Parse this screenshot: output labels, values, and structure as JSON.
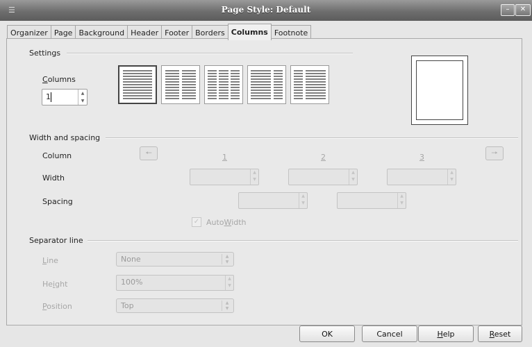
{
  "window": {
    "title": "Page Style: Default"
  },
  "tabs": [
    {
      "label": "Organizer"
    },
    {
      "label": "Page"
    },
    {
      "label": "Background"
    },
    {
      "label": "Header"
    },
    {
      "label": "Footer"
    },
    {
      "label": "Borders"
    },
    {
      "label": "Columns"
    },
    {
      "label": "Footnote"
    }
  ],
  "active_tab": "Columns",
  "settings": {
    "heading": "Settings",
    "columns_label_letter": "C",
    "columns_label_rest": "olumns",
    "columns_value": "1",
    "layouts": [
      "1 column",
      "2 columns",
      "3 columns",
      "2 columns left-weighted",
      "2 columns right-weighted"
    ]
  },
  "width_spacing": {
    "heading": "Width and spacing",
    "column_label": "Column",
    "width_label": "Width",
    "spacing_label": "Spacing",
    "col_numbers": [
      "1",
      "2",
      "3"
    ],
    "autowidth_pre": "Auto",
    "autowidth_letter": "W",
    "autowidth_post": "idth"
  },
  "separator": {
    "heading": "Separator line",
    "line_letter": "L",
    "line_rest": "ine",
    "height_pre": "He",
    "height_letter": "i",
    "height_post": "ght",
    "position_letter": "P",
    "position_rest": "osition",
    "line_value": "None",
    "height_value": "100%",
    "position_value": "Top"
  },
  "buttons": {
    "ok": "OK",
    "cancel": "Cancel",
    "help_letter": "H",
    "help_rest": "elp",
    "reset_letter": "R",
    "reset_rest": "eset"
  },
  "icons": {
    "prev": "left-arrow-icon",
    "next": "right-arrow-icon"
  }
}
